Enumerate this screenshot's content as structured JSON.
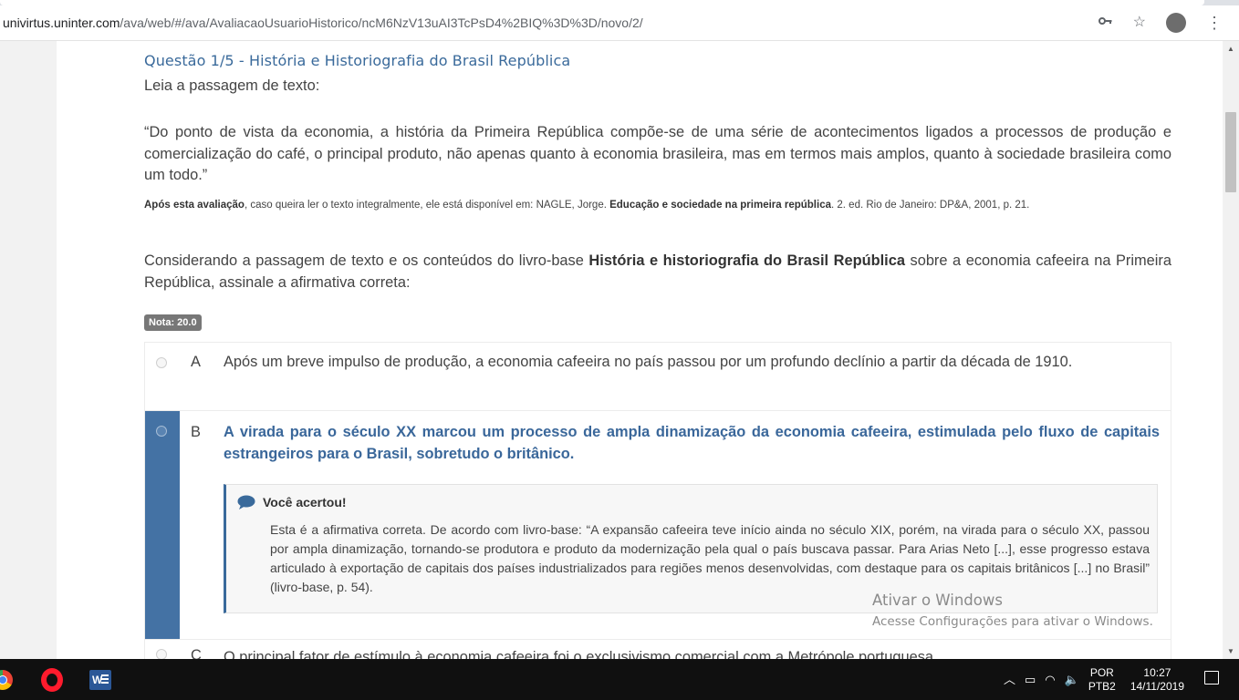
{
  "browser": {
    "url_domain": "univirtus.uninter.com",
    "url_path": "/ava/web/#/ava/AvaliacaoUsuarioHistorico/ncM6NzV13uAI3TcPsD4%2BIQ%3D%3D/novo/2/",
    "icons": [
      "key-icon",
      "star-icon",
      "profile-avatar",
      "menu-kebab-icon"
    ]
  },
  "question": {
    "title": "Questão 1/5 - História e Historiografia do Brasil República",
    "instruction": "Leia a passagem de texto:",
    "quote": "“Do ponto de vista da economia, a história da Primeira República compõe-se de uma série de acontecimentos ligados a processos de produção e comercialização do café, o principal produto, não apenas quanto à economia brasileira, mas em termos mais amplos, quanto à sociedade brasileira como um todo.”",
    "ref_bold1": "Após esta avaliação",
    "ref_text1": ", caso queira ler o texto integralmente, ele está disponível em: NAGLE, Jorge. ",
    "ref_bold2": "Educação e sociedade na primeira república",
    "ref_text2": ". 2. ed. Rio de Janeiro: DP&A, 2001, p. 21.",
    "consider_1": "Considerando a passagem de texto e os conteúdos do livro-base ",
    "consider_bold": "História e historiografia do Brasil República",
    "consider_2": " sobre a economia cafeeira na Primeira República, assinale a afirmativa correta:",
    "nota": "Nota: 20.0"
  },
  "options": {
    "a": {
      "letter": "A",
      "text": "Após um breve impulso de produção, a economia cafeeira no país passou por um profundo declínio a partir da década de 1910."
    },
    "b": {
      "letter": "B",
      "text": "A virada para o século XX marcou um processo de ampla dinamização da economia cafeeira, estimulada pelo fluxo de capitais estrangeiros para o Brasil, sobretudo o britânico."
    },
    "c": {
      "letter": "C",
      "text": "O principal fator de estímulo à economia cafeeira foi o exclusivismo comercial com a Metrópole portuguesa."
    }
  },
  "feedback": {
    "title": "Você acertou!",
    "text": "Esta é a afirmativa correta. De acordo com livro-base: “A expansão cafeeira teve início ainda no século XIX, porém, na virada para o século XX, passou por ampla dinamização, tornando-se produtora e produto da modernização pela qual o país buscava passar. Para Arias Neto [...], esse progresso estava articulado à exportação de capitais dos países industrializados para regiões menos desenvolvidas, com destaque para os capitais britânicos [...] no Brasil” (livro-base, p. 54)."
  },
  "watermark": {
    "line1": "Ativar o Windows",
    "line2": "Acesse Configurações para ativar o Windows."
  },
  "taskbar": {
    "lang_top": "POR",
    "lang_bottom": "PTB2",
    "time": "10:27",
    "date": "14/11/2019"
  }
}
